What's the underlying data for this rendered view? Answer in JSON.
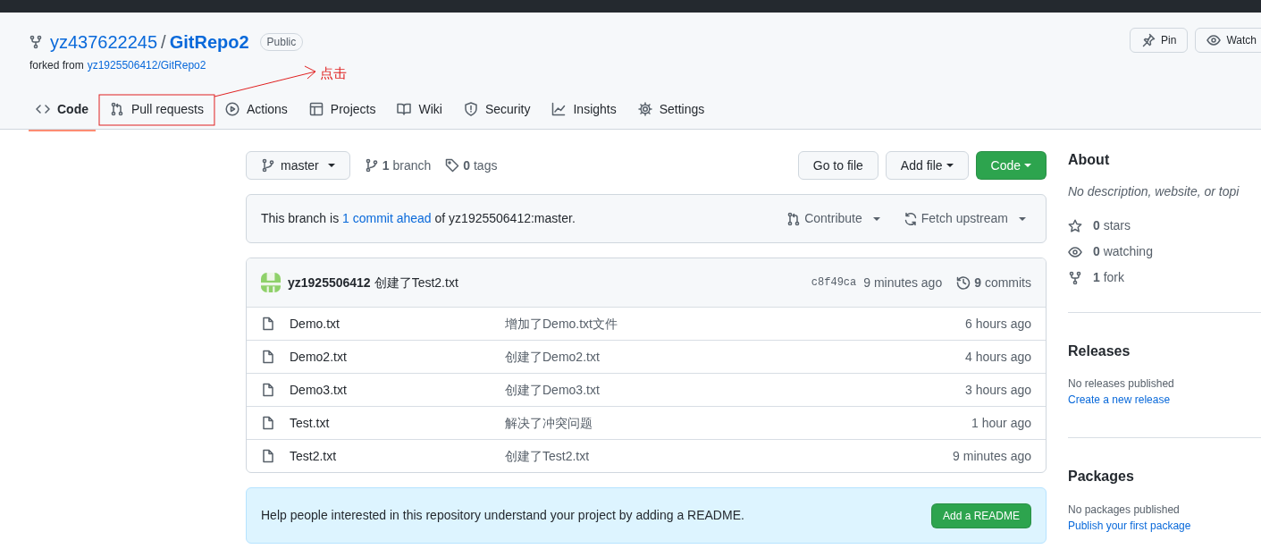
{
  "repo": {
    "owner": "yz437622245",
    "separator": "/",
    "name": "GitRepo2",
    "visibility": "Public",
    "forked_prefix": "forked from",
    "forked_source": "yz1925506412/GitRepo2"
  },
  "header_buttons": [
    {
      "label": "Pin"
    },
    {
      "label": "Watch"
    }
  ],
  "tabs": [
    {
      "label": "Code",
      "selected": true,
      "highlighted": false
    },
    {
      "label": "Pull requests",
      "selected": false,
      "highlighted": true
    },
    {
      "label": "Actions",
      "selected": false,
      "highlighted": false
    },
    {
      "label": "Projects",
      "selected": false,
      "highlighted": false
    },
    {
      "label": "Wiki",
      "selected": false,
      "highlighted": false
    },
    {
      "label": "Security",
      "selected": false,
      "highlighted": false
    },
    {
      "label": "Insights",
      "selected": false,
      "highlighted": false
    },
    {
      "label": "Settings",
      "selected": false,
      "highlighted": false
    }
  ],
  "annotation": {
    "text": "点击"
  },
  "toolbar": {
    "branch": "master",
    "branches": "**1** branch",
    "tags": "**0** tags",
    "buttons": [
      {
        "label": "Go to file",
        "kind": "plain"
      },
      {
        "label": "Add file",
        "kind": "dropdown"
      },
      {
        "label": "Code",
        "kind": "primary"
      }
    ]
  },
  "branch_status": {
    "before": "This branch is",
    "link": "1 commit ahead",
    "after": "of yz1925506412:master.",
    "actions": [
      "Contribute",
      "Fetch upstream"
    ]
  },
  "latest_commit": {
    "author": "yz1925506412",
    "message": "创建了Test2.txt",
    "sha": "c8f49ca",
    "time": "9 minutes ago",
    "commits": "**9** commits"
  },
  "files": [
    {
      "name": "Demo.txt",
      "message": "增加了Demo.txt文件",
      "time": "6 hours ago"
    },
    {
      "name": "Demo2.txt",
      "message": "创建了Demo2.txt",
      "time": "4 hours ago"
    },
    {
      "name": "Demo3.txt",
      "message": "创建了Demo3.txt",
      "time": "3 hours ago"
    },
    {
      "name": "Test.txt",
      "message": "解决了冲突问题",
      "time": "1 hour ago"
    },
    {
      "name": "Test2.txt",
      "message": "创建了Test2.txt",
      "time": "9 minutes ago"
    }
  ],
  "readme_banner": {
    "text": "Help people interested in this repository understand your project by adding a README.",
    "button": "Add a README"
  },
  "sidebar": {
    "about": {
      "title": "About",
      "description": "No description, website, or topi",
      "stats": [
        "**0** stars",
        "**0** watching",
        "**1** fork"
      ]
    },
    "releases": {
      "title": "Releases",
      "note": "No releases published",
      "link": "Create a new release"
    },
    "packages": {
      "title": "Packages",
      "note": "No packages published",
      "link": "Publish your first package"
    }
  }
}
